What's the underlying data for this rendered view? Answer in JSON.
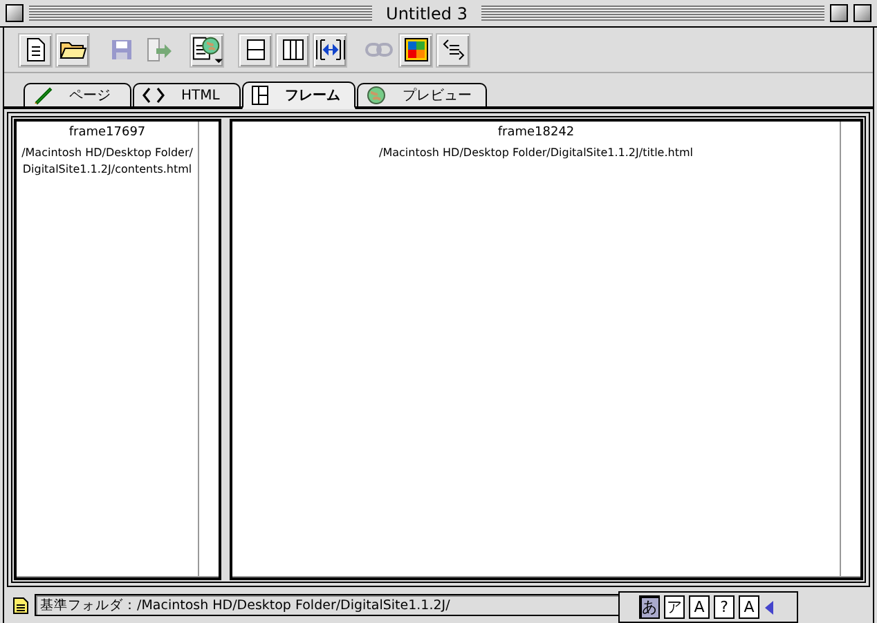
{
  "window": {
    "title": "Untitled 3"
  },
  "toolbar": [
    {
      "kind": "new",
      "disabled": false
    },
    {
      "kind": "open",
      "disabled": false
    },
    {
      "kind": "save",
      "disabled": true
    },
    {
      "kind": "export",
      "disabled": true
    },
    {
      "kind": "globe",
      "disabled": false
    },
    {
      "kind": "rows",
      "disabled": false
    },
    {
      "kind": "cols",
      "disabled": false
    },
    {
      "kind": "resize",
      "disabled": false
    },
    {
      "kind": "link",
      "disabled": true
    },
    {
      "kind": "color",
      "disabled": false
    },
    {
      "kind": "source",
      "disabled": false
    }
  ],
  "tabs": [
    {
      "kind": "pencil",
      "label": "ページ",
      "selected": false
    },
    {
      "kind": "code",
      "label": "HTML",
      "selected": false
    },
    {
      "kind": "frame",
      "label": "フレーム",
      "selected": true
    },
    {
      "kind": "globe",
      "label": "プレビュー",
      "selected": false
    }
  ],
  "frames": [
    {
      "name": "frame17697",
      "path": "/Macintosh HD/Desktop Folder/DigitalSite1.1.2J/contents.html"
    },
    {
      "name": "frame18242",
      "path": "/Macintosh HD/Desktop Folder/DigitalSite1.1.2J/title.html"
    }
  ],
  "status_bar": {
    "text": "基準フォルダ：/Macintosh HD/Desktop Folder/DigitalSite1.1.2J/"
  },
  "ime_palette": {
    "keys": [
      {
        "label": "あ",
        "selected": true
      },
      {
        "label": "ア",
        "selected": false
      },
      {
        "label": "A",
        "selected": false
      },
      {
        "label": "?",
        "selected": false
      },
      {
        "label": "A",
        "selected": false
      }
    ]
  }
}
